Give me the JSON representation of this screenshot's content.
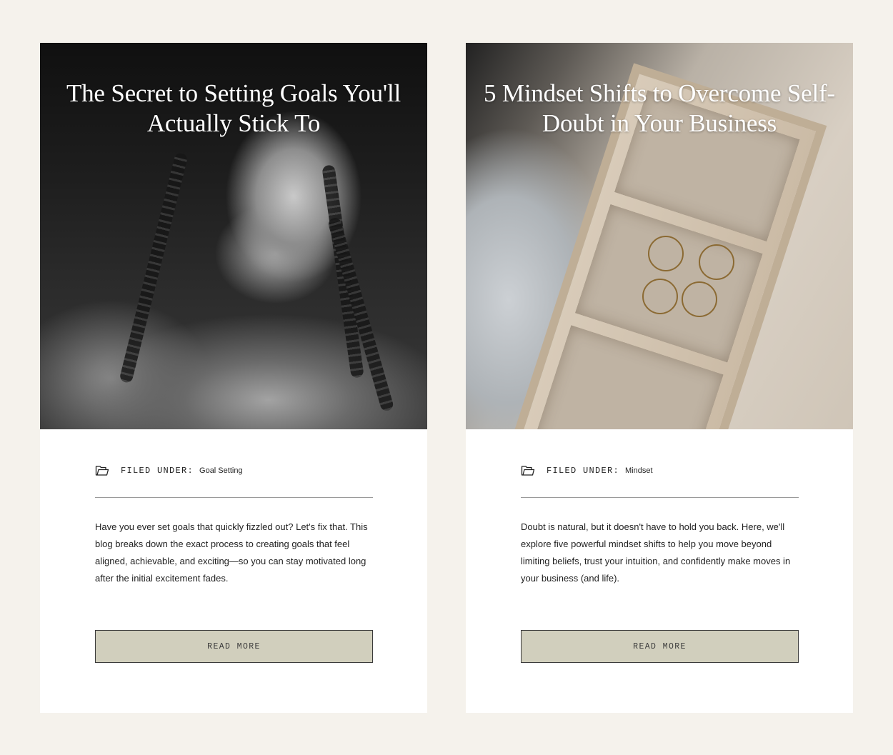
{
  "posts": [
    {
      "title": "The Secret to Setting Goals You'll Actually Stick To",
      "meta_label": "FILED UNDER:",
      "category": "Goal Setting",
      "excerpt": "Have you ever set goals that quickly fizzled out? Let's fix that. This blog breaks down the exact process to creating goals that feel aligned, achievable, and exciting—so you can stay motivated long after the initial excitement fades.",
      "button_label": "READ MORE",
      "icon": "folder-icon"
    },
    {
      "title": "5 Mindset Shifts to Overcome Self-Doubt in Your Business",
      "meta_label": "FILED UNDER:",
      "category": "Mindset",
      "excerpt": "Doubt is natural, but it doesn't have to hold you back. Here, we'll explore five powerful mindset shifts to help you move beyond limiting beliefs, trust your intuition, and confidently make moves in your business (and life).",
      "button_label": "READ MORE",
      "icon": "folder-icon"
    }
  ],
  "colors": {
    "page_background": "#f5f2ec",
    "card_background": "#ffffff",
    "button_background": "#d1cfbd",
    "button_border": "#3a3a3a",
    "text": "#222222"
  }
}
